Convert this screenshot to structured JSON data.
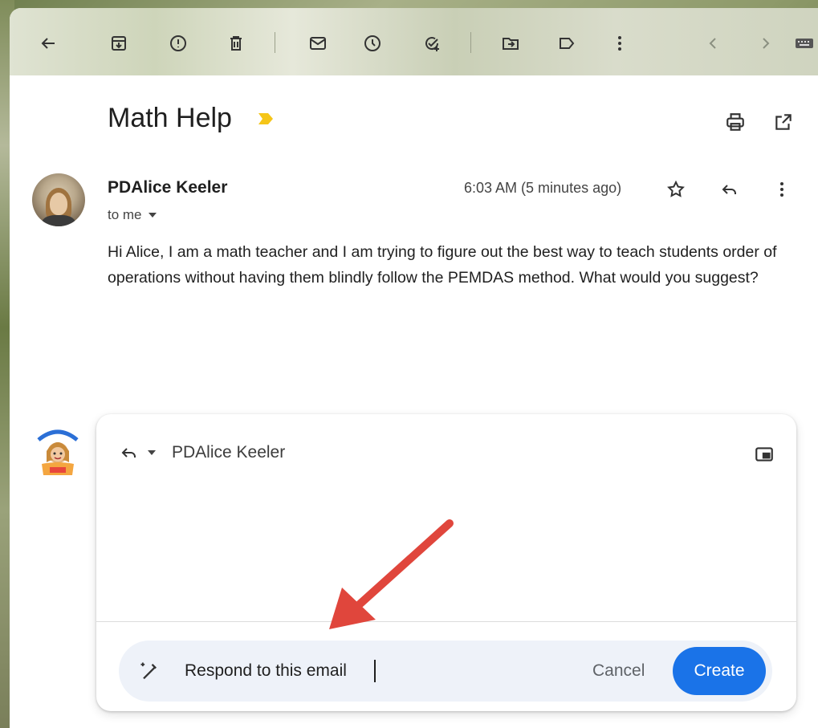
{
  "toolbar": {
    "icons": [
      "back-arrow-icon",
      "archive-icon",
      "report-spam-icon",
      "delete-icon",
      "mark-unread-icon",
      "snooze-icon",
      "add-to-tasks-icon",
      "move-to-icon",
      "labels-icon",
      "more-vert-icon",
      "prev-icon",
      "next-icon",
      "keyboard-icon"
    ]
  },
  "email": {
    "subject": "Math Help",
    "sender": "PDAlice Keeler",
    "recipient_line": "to me",
    "timestamp": "6:03 AM (5 minutes ago)",
    "body": "Hi Alice, I am a math teacher and I am trying to figure out the best way to teach students order of operations without having them blindly follow the PEMDAS method. What would you suggest?"
  },
  "reply": {
    "recipient": "PDAlice Keeler",
    "prompt_value": "Respond to this email",
    "cancel_label": "Cancel",
    "create_label": "Create"
  },
  "colors": {
    "accent": "#1a73e8",
    "important_marker": "#f5c518",
    "annotation_arrow": "#e0463c"
  }
}
